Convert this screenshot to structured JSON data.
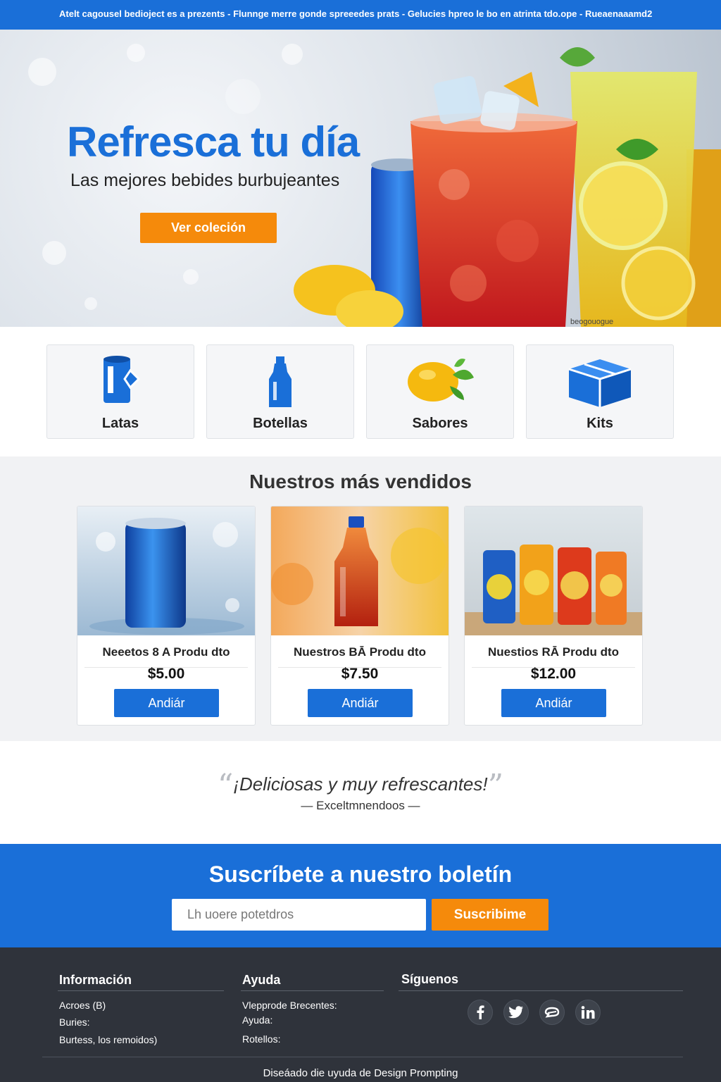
{
  "topbar": {
    "text": "Atelt cagousel bedioject es a prezents - Flunnge merre gonde spreeedes prats - Gelucies hpreo le bo en atrinta tdo.ope - Rueaenaaamd2"
  },
  "hero": {
    "title": "Refresca tu día",
    "subtitle": "Las mejores bebides burbujeantes",
    "button": "Ver coleción",
    "watermark": "beogouogue"
  },
  "categories": [
    {
      "label": "Latas",
      "icon": "can-icon"
    },
    {
      "label": "Botellas",
      "icon": "bottle-icon"
    },
    {
      "label": "Sabores",
      "icon": "lemon-icon"
    },
    {
      "label": "Kits",
      "icon": "box-icon"
    }
  ],
  "bestsellers": {
    "title": "Nuestros más vendidos",
    "products": [
      {
        "name": "Neeetos 8 A Produ dto",
        "price": "$5.00",
        "button": "Andiár",
        "image": "blue-can"
      },
      {
        "name": "Nuestros BĀ Produ dto",
        "price": "$7.50",
        "button": "Andiár",
        "image": "red-bottle"
      },
      {
        "name": "Nuestios RĀ Produ dto",
        "price": "$12.00",
        "button": "Andiár",
        "image": "cans-set"
      }
    ]
  },
  "testimonial": {
    "quote": "¡Deliciosas y muy refrescantes!",
    "author": "— Exceltmnendoos —"
  },
  "newsletter": {
    "title": "Suscríbete a nuestro boletín",
    "placeholder": "Lh uoere potetdros",
    "button": "Suscribime"
  },
  "footer": {
    "columns": [
      {
        "title": "Información",
        "links": [
          "Acroes (B)",
          "Buries:",
          "Burtess, los remoidos)"
        ]
      },
      {
        "title": "Ayuda",
        "links": [
          "Vlepprode Brecentes:",
          "Ayuda:",
          "Rotellos:"
        ]
      },
      {
        "title": "Síguenos",
        "links": []
      }
    ],
    "social": [
      "facebook-icon",
      "twitter-icon",
      "chat-icon",
      "linkedin-icon"
    ],
    "credit": "Diseáado die uyuda de  Design Prompting"
  },
  "colors": {
    "brand_blue": "#1a6fd8",
    "accent_orange": "#f58a0b",
    "footer_bg": "#2f333b"
  }
}
